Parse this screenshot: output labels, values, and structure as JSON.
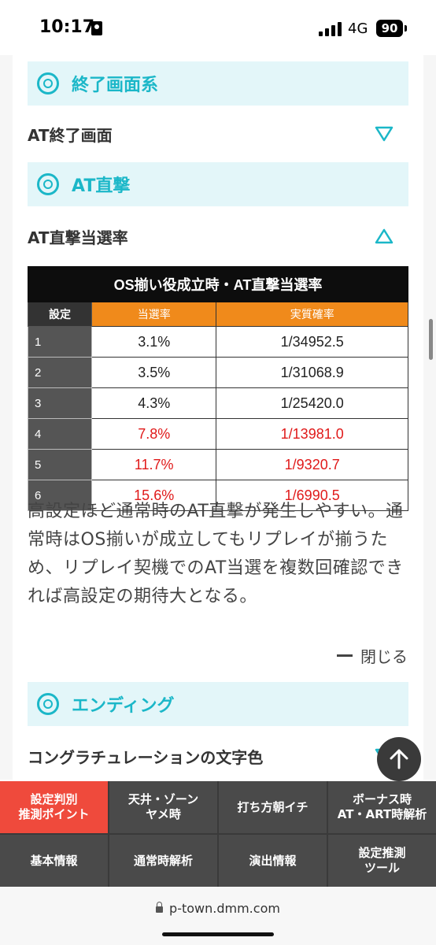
{
  "status_bar": {
    "time": "10:17",
    "network": "4G",
    "battery": "90"
  },
  "sections": {
    "end_screen": {
      "title": "終了画面系",
      "item": "AT終了画面"
    },
    "at_direct": {
      "title": "AT直撃",
      "item": "AT直撃当選率"
    },
    "ending": {
      "title": "エンディング",
      "item": "コングラチュレーションの文字色"
    }
  },
  "table": {
    "caption": "OS揃い役成立時・AT直撃当選率",
    "headers": [
      "設定",
      "当選率",
      "実質確率"
    ],
    "rows": [
      {
        "setting": "1",
        "rate": "3.1%",
        "prob": "1/34952.5"
      },
      {
        "setting": "2",
        "rate": "3.5%",
        "prob": "1/31068.9"
      },
      {
        "setting": "3",
        "rate": "4.3%",
        "prob": "1/25420.0"
      },
      {
        "setting": "4",
        "rate": "7.8%",
        "prob": "1/13981.0"
      },
      {
        "setting": "5",
        "rate": "11.7%",
        "prob": "1/9320.7"
      },
      {
        "setting": "6",
        "rate": "15.6%",
        "prob": "1/6990.5"
      }
    ],
    "highlight_color": "#e01a1a"
  },
  "description": "高設定ほど通常時のAT直撃が発生しやすい。通常時はOS揃いが成立してもリプレイが揃うため、リプレイ契機でのAT当選を複数回確認できれば高設定の期待大となる。",
  "close_label": "閉じる",
  "bottom_nav": [
    "設定判別\n推測ポイント",
    "天井・ゾーン\nヤメ時",
    "打ち方朝イチ",
    "ボーナス時\nAT・ART時解析",
    "基本情報",
    "通常時解析",
    "演出情報",
    "設定推測\nツール"
  ],
  "url": "p-town.dmm.com",
  "colors": {
    "accent": "#1bb7c8",
    "header_orange": "#f08a1b",
    "nav_active": "#ef4a3c"
  }
}
